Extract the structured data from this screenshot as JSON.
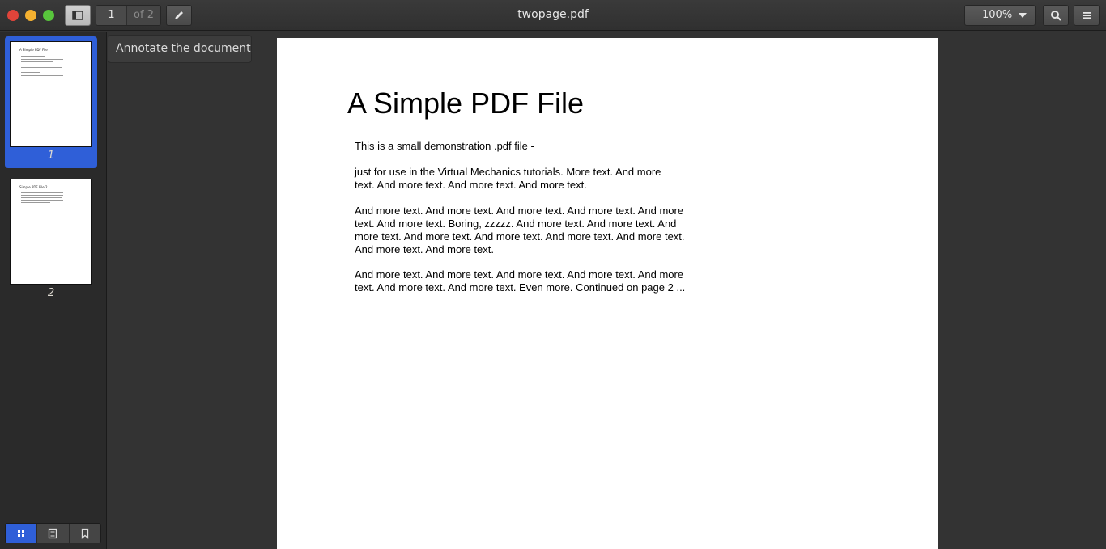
{
  "window": {
    "title": "twopage.pdf"
  },
  "toolbar": {
    "current_page": "1",
    "page_count_label": "of 2",
    "zoom_value": "100%",
    "tooltip": "Annotate the document"
  },
  "sidebar": {
    "thumbnails": [
      {
        "label": "1",
        "mini_title": "A Simple PDF File"
      },
      {
        "label": "2",
        "mini_title": "Simple PDF File 2"
      }
    ],
    "modes": [
      "thumbnails",
      "outline",
      "bookmarks"
    ]
  },
  "document": {
    "title": "A Simple PDF File",
    "paragraphs": [
      [
        "This is a small demonstration .pdf file -"
      ],
      [
        "just for use in the Virtual Mechanics tutorials. More text. And more",
        "text. And more text. And more text. And more text."
      ],
      [
        "And more text. And more text. And more text. And more text. And more",
        "text. And more text. Boring, zzzzz. And more text. And more text. And",
        "more text. And more text. And more text. And more text. And more text.",
        "And more text. And more text."
      ],
      [
        "And more text. And more text. And more text. And more text. And more",
        "text. And more text. And more text. Even more. Continued on page 2 ..."
      ]
    ]
  },
  "colors": {
    "accent": "#2f5fd8",
    "close": "#e0443a",
    "minimize": "#f5b130",
    "maximize": "#58c53c"
  }
}
